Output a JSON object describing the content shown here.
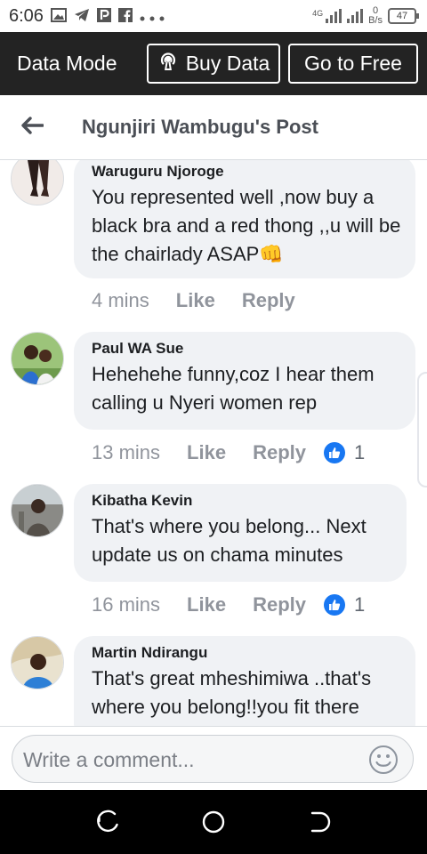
{
  "status": {
    "time": "6:06",
    "network": "4G",
    "speed_value": "0",
    "speed_unit": "B/s",
    "battery": "47"
  },
  "data_mode": {
    "label": "Data Mode",
    "buy_label": "Buy Data",
    "free_label": "Go to Free"
  },
  "header": {
    "title": "Ngunjiri Wambugu's Post"
  },
  "comments": [
    {
      "author": "Waruguru Njoroge",
      "text": "You represented well ,now buy a black bra and a red thong ,,u will be the chairlady ASAP👊",
      "time": "4 mins",
      "like": "Like",
      "reply": "Reply",
      "reactions": ""
    },
    {
      "author": "Paul WA Sue",
      "text": "Hehehehe funny,coz I hear them calling u Nyeri women rep",
      "time": "13 mins",
      "like": "Like",
      "reply": "Reply",
      "reactions": "1"
    },
    {
      "author": "Kibatha Kevin",
      "text": "That's where you belong... Next update us on chama minutes",
      "time": "16 mins",
      "like": "Like",
      "reply": "Reply",
      "reactions": "1"
    },
    {
      "author": "Martin Ndirangu",
      "text": "That's great mheshimiwa ..that's where you belong!!you fit there",
      "time": "",
      "like": "",
      "reply": "",
      "reactions": ""
    }
  ],
  "composer": {
    "placeholder": "Write a comment..."
  },
  "colors": {
    "data_bar": "#232323",
    "bubble": "#f0f2f5",
    "meta_text": "#90949c",
    "like_blue": "#1877f2"
  }
}
